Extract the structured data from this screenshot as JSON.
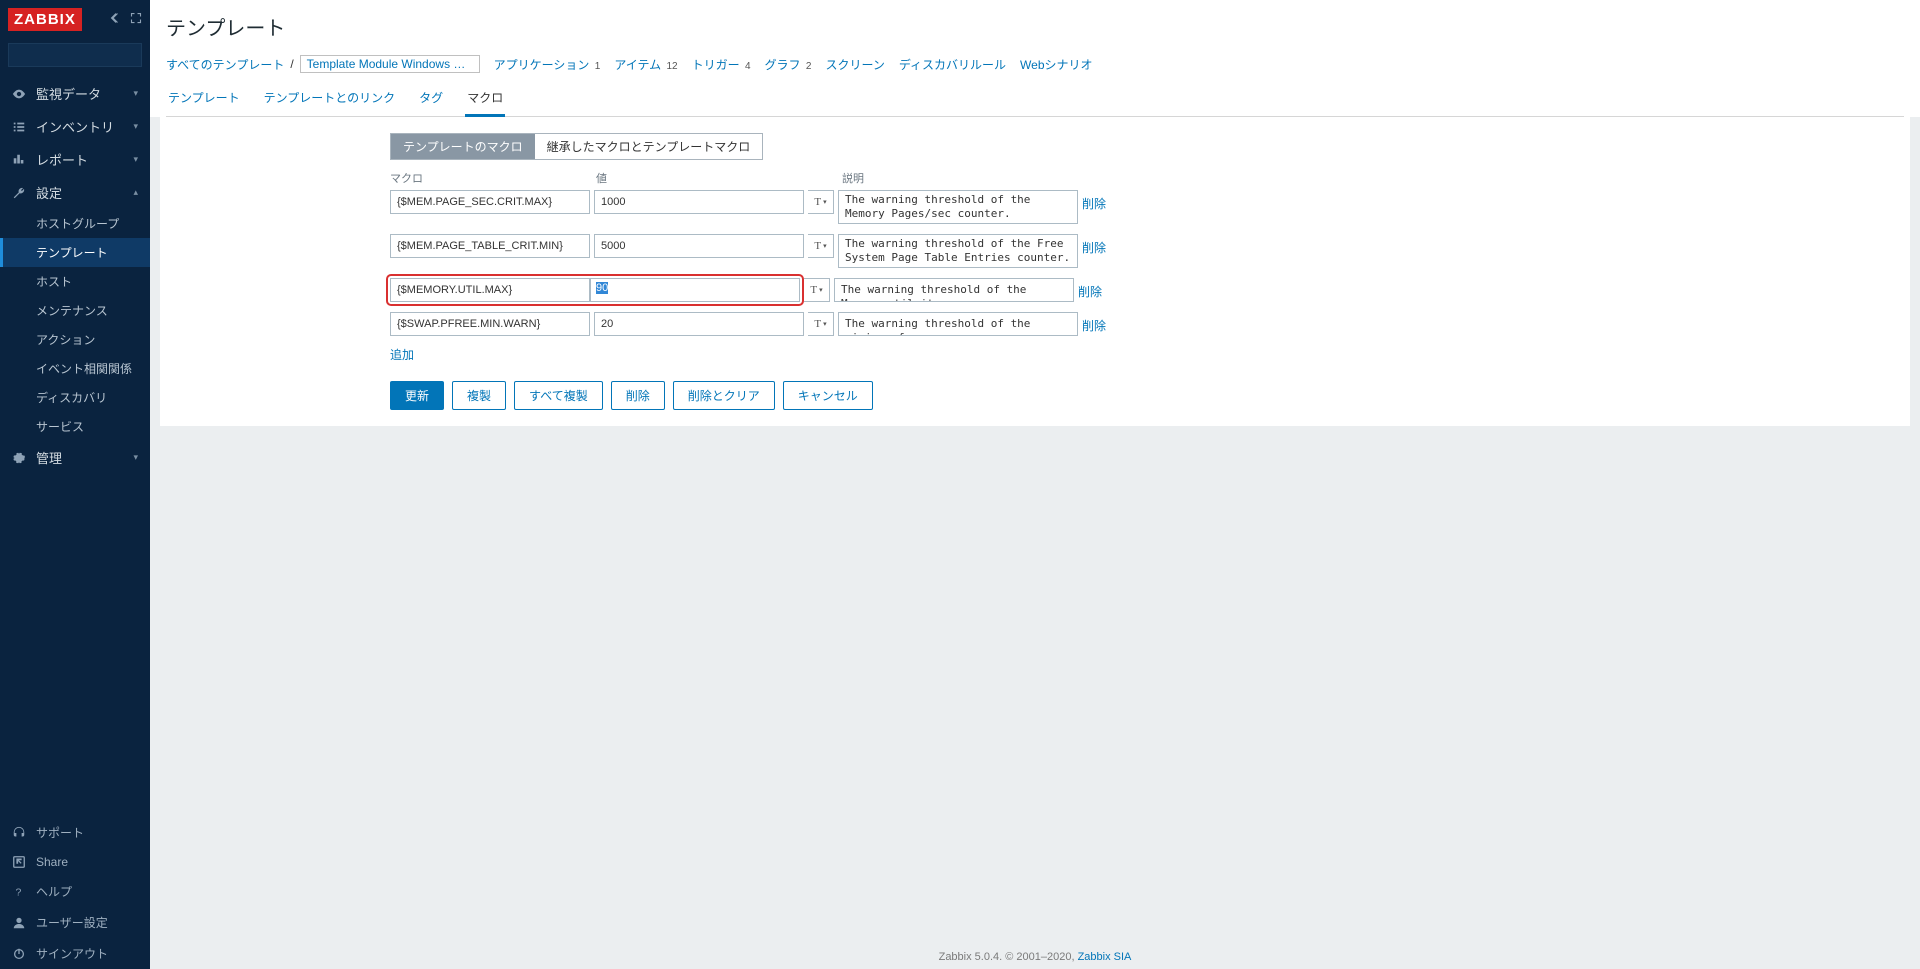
{
  "brand": "ZABBIX",
  "page_title": "テンプレート",
  "sidebar": {
    "search_placeholder": "",
    "items": [
      {
        "label": "監視データ"
      },
      {
        "label": "インベントリ"
      },
      {
        "label": "レポート"
      },
      {
        "label": "設定"
      },
      {
        "label": "管理"
      }
    ],
    "config_sub": [
      {
        "label": "ホストグループ"
      },
      {
        "label": "テンプレート"
      },
      {
        "label": "ホスト"
      },
      {
        "label": "メンテナンス"
      },
      {
        "label": "アクション"
      },
      {
        "label": "イベント相関関係"
      },
      {
        "label": "ディスカバリ"
      },
      {
        "label": "サービス"
      }
    ],
    "bottom": [
      {
        "label": "サポート"
      },
      {
        "label": "Share"
      },
      {
        "label": "ヘルプ"
      },
      {
        "label": "ユーザー設定"
      },
      {
        "label": "サインアウト"
      }
    ]
  },
  "breadcrumb": {
    "all_templates": "すべてのテンプレート",
    "current": "Template Module Windows memo...",
    "counts": [
      {
        "label": "アプリケーション",
        "n": "1"
      },
      {
        "label": "アイテム",
        "n": "12"
      },
      {
        "label": "トリガー",
        "n": "4"
      },
      {
        "label": "グラフ",
        "n": "2"
      },
      {
        "label": "スクリーン",
        "n": ""
      },
      {
        "label": "ディスカバリルール",
        "n": ""
      },
      {
        "label": "Webシナリオ",
        "n": ""
      }
    ]
  },
  "tabs": [
    "テンプレート",
    "テンプレートとのリンク",
    "タグ",
    "マクロ"
  ],
  "active_tab": "マクロ",
  "toggle": {
    "a": "テンプレートのマクロ",
    "b": "継承したマクロとテンプレートマクロ"
  },
  "col_headers": {
    "macro": "マクロ",
    "value": "値",
    "desc": "説明"
  },
  "rows": [
    {
      "name": "{$MEM.PAGE_SEC.CRIT.MAX}",
      "value": "1000",
      "desc": "The warning threshold of the Memory Pages/sec counter.",
      "short": false
    },
    {
      "name": "{$MEM.PAGE_TABLE_CRIT.MIN}",
      "value": "5000",
      "desc": "The warning threshold of the Free System Page Table Entries counter.",
      "short": false
    },
    {
      "name": "{$MEMORY.UTIL.MAX}",
      "value": "90",
      "desc": "The warning threshold of the Memory util item.",
      "short": true,
      "highlight": true
    },
    {
      "name": "{$SWAP.PFREE.MIN.WARN}",
      "value": "20",
      "desc": "The warning threshold of the minimum free swap.",
      "short": true
    }
  ],
  "add_label": "追加",
  "del_label": "削除",
  "buttons": {
    "update": "更新",
    "clone": "複製",
    "clone_all": "すべて複製",
    "delete": "削除",
    "delete_clear": "削除とクリア",
    "cancel": "キャンセル"
  },
  "footer": {
    "text": "Zabbix 5.0.4. © 2001–2020, ",
    "link": "Zabbix SIA"
  }
}
